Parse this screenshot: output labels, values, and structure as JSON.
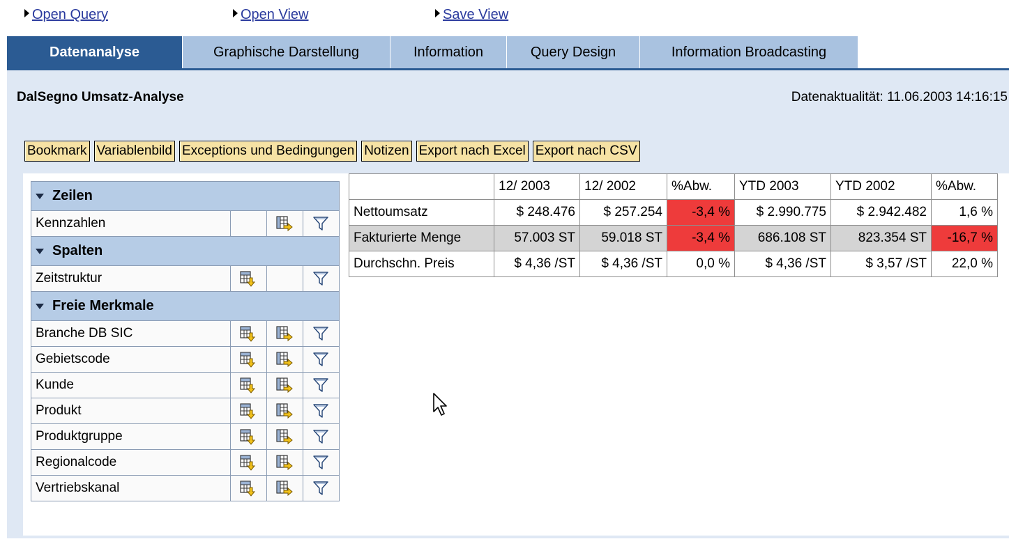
{
  "top_links": [
    "Open Query",
    "Open View",
    "Save View"
  ],
  "tabs": [
    "Datenanalyse",
    "Graphische Darstellung",
    "Information",
    "Query Design",
    "Information Broadcasting"
  ],
  "report": {
    "title": "DalSegno Umsatz-Analyse",
    "freshness": "Datenaktualität: 11.06.2003 14:16:15"
  },
  "toolbar": [
    "Bookmark",
    "Variablenbild",
    "Exceptions und Bedingungen",
    "Notizen",
    "Export nach Excel",
    "Export nach CSV"
  ],
  "navigation": {
    "sections": [
      {
        "title": "Zeilen",
        "items": [
          {
            "label": "Kennzahlen"
          }
        ]
      },
      {
        "title": "Spalten",
        "items": [
          {
            "label": "Zeitstruktur"
          }
        ]
      },
      {
        "title": "Freie Merkmale",
        "items": [
          {
            "label": "Branche DB SIC"
          },
          {
            "label": "Gebietscode"
          },
          {
            "label": "Kunde"
          },
          {
            "label": "Produkt"
          },
          {
            "label": "Produktgruppe"
          },
          {
            "label": "Regionalcode"
          },
          {
            "label": "Vertriebskanal"
          }
        ]
      }
    ]
  },
  "grid": {
    "columns": [
      "12/ 2003",
      "12/ 2002",
      "%Abw.",
      "YTD 2003",
      "YTD 2002",
      "%Abw."
    ],
    "rows": [
      {
        "label": "Nettoumsatz",
        "cells": [
          "$ 248.476",
          "$ 257.254",
          "-3,4 %",
          "$ 2.990.775",
          "$ 2.942.482",
          "1,6 %"
        ]
      },
      {
        "label": "Fakturierte Menge",
        "cells": [
          "57.003 ST",
          "59.018 ST",
          "-3,4 %",
          "686.108 ST",
          "823.354 ST",
          "-16,7 %"
        ]
      },
      {
        "label": "Durchschn. Preis",
        "cells": [
          "$ 4,36 /ST",
          "$ 4,36 /ST",
          "0,0 %",
          "$ 4,36 /ST",
          "$ 3,57 /ST",
          "22,0 %"
        ]
      }
    ]
  },
  "colors": {
    "exception_red": "#ee3b3b",
    "tab_active": "#2b5b93",
    "tab_inactive": "#a9c2e0",
    "button_yellow": "#f6e2a4"
  }
}
